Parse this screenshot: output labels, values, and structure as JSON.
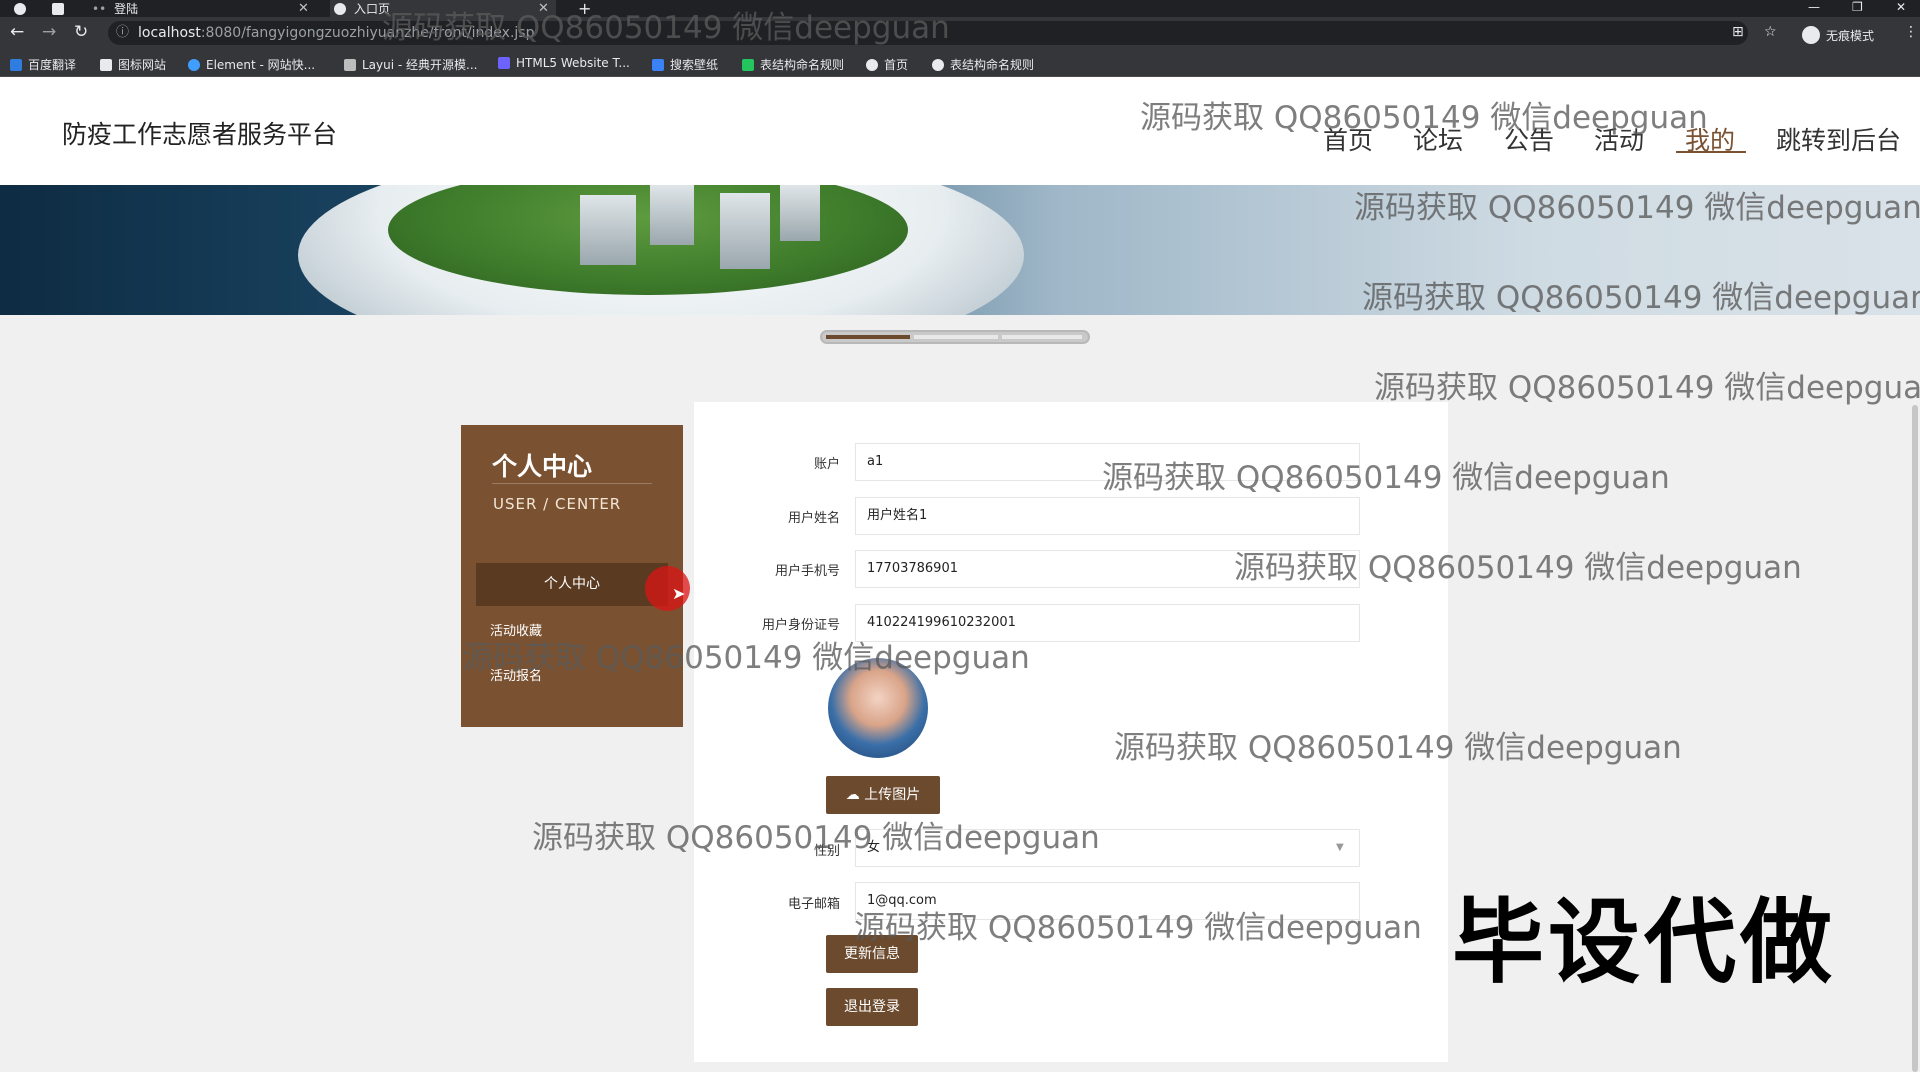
{
  "browser": {
    "tabs": [
      {
        "label": "登陆"
      },
      {
        "label": "入口页"
      }
    ],
    "url_host": "localhost",
    "url_path": ":8080/fangyigongzuozhiyuanzhe/front/index.jsp",
    "incognito_label": "无痕模式",
    "bookmarks": [
      {
        "label": "百度翻译"
      },
      {
        "label": "图标网站"
      },
      {
        "label": "Element - 网站快..."
      },
      {
        "label": "Layui - 经典开源模..."
      },
      {
        "label": "HTML5 Website T..."
      },
      {
        "label": "搜索壁纸"
      },
      {
        "label": "表结构命名规则"
      },
      {
        "label": "首页"
      },
      {
        "label": "表结构命名规则"
      }
    ]
  },
  "site": {
    "title": "防疫工作志愿者服务平台",
    "nav": [
      {
        "label": "首页"
      },
      {
        "label": "论坛"
      },
      {
        "label": "公告"
      },
      {
        "label": "活动"
      },
      {
        "label": "我的"
      },
      {
        "label": "跳转到后台"
      }
    ],
    "active_nav": "我的",
    "accent_color": "#7b5231"
  },
  "sidebar": {
    "title": "个人中心",
    "subtitle": "USER / CENTER",
    "active_item": "个人中心",
    "items": [
      {
        "label": "活动收藏"
      },
      {
        "label": "活动报名"
      }
    ]
  },
  "form": {
    "fields": [
      {
        "label": "账户",
        "value": "a1"
      },
      {
        "label": "用户姓名",
        "value": "用户姓名1"
      },
      {
        "label": "用户手机号",
        "value": "17703786901"
      },
      {
        "label": "用户身份证号",
        "value": "410224199610232001"
      }
    ],
    "upload_label": "上传图片",
    "gender_label": "性别",
    "gender_value": "女",
    "email_label": "电子邮箱",
    "email_value": "1@qq.com",
    "update_label": "更新信息",
    "logout_label": "退出登录"
  },
  "watermarks": {
    "text": "源码获取 QQ86050149 微信deepguan",
    "promo": "毕设代做"
  }
}
